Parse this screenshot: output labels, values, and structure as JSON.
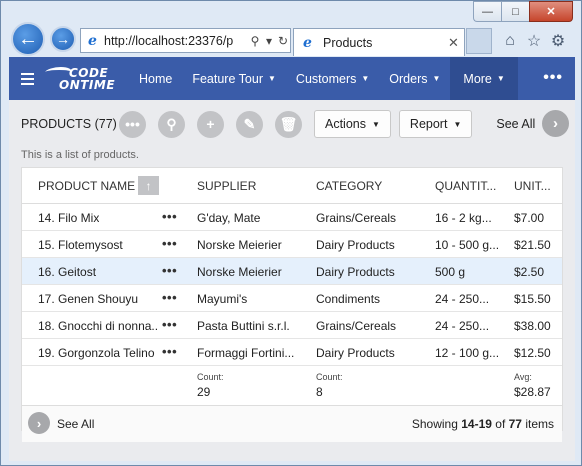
{
  "browser": {
    "address": "http://localhost:23376/p",
    "tab_title": "Products"
  },
  "nav": {
    "logo_line1": "CODE",
    "logo_line2": "ONTIME",
    "items": [
      {
        "label": "Home",
        "caret": ""
      },
      {
        "label": "Feature Tour",
        "caret": "▼"
      },
      {
        "label": "Customers",
        "caret": "▼"
      },
      {
        "label": "Orders",
        "caret": "▼"
      },
      {
        "label": "More",
        "caret": "▼"
      }
    ],
    "more_dots": "•••"
  },
  "toolbar": {
    "view_title": "PRODUCTS (77)",
    "actions_label": "Actions",
    "report_label": "Report",
    "see_all_label": "See All"
  },
  "description": "This is a list of products.",
  "grid": {
    "headers": [
      "PRODUCT NAME",
      "SUPPLIER",
      "CATEGORY",
      "QUANTIT...",
      "UNIT..."
    ],
    "rows": [
      {
        "name": "14. Filo Mix",
        "supplier": "G'day, Mate",
        "category": "Grains/Cereals",
        "quantity": "16 - 2 kg...",
        "unit": "$7.00",
        "selected": false
      },
      {
        "name": "15. Flotemysost",
        "supplier": "Norske Meierier",
        "category": "Dairy Products",
        "quantity": "10 - 500 g...",
        "unit": "$21.50",
        "selected": false
      },
      {
        "name": "16. Geitost",
        "supplier": "Norske Meierier",
        "category": "Dairy Products",
        "quantity": "500 g",
        "unit": "$2.50",
        "selected": true
      },
      {
        "name": "17. Genen Shouyu",
        "supplier": "Mayumi's",
        "category": "Condiments",
        "quantity": "24 - 250...",
        "unit": "$15.50",
        "selected": false
      },
      {
        "name": "18. Gnocchi di nonna...",
        "supplier": "Pasta Buttini s.r.l.",
        "category": "Grains/Cereals",
        "quantity": "24 - 250...",
        "unit": "$38.00",
        "selected": false
      },
      {
        "name": "19. Gorgonzola Telino",
        "supplier": "Formaggi Fortini...",
        "category": "Dairy Products",
        "quantity": "12 - 100 g...",
        "unit": "$12.50",
        "selected": false
      }
    ],
    "aggregates": {
      "supplier_label": "Count:",
      "supplier_value": "29",
      "category_label": "Count:",
      "category_value": "8",
      "unit_label": "Avg:",
      "unit_value": "$28.87"
    }
  },
  "footer": {
    "see_all_label": "See All",
    "showing_prefix": "Showing",
    "range": "14-19",
    "of": "of",
    "total": "77",
    "items_suffix": "items"
  }
}
